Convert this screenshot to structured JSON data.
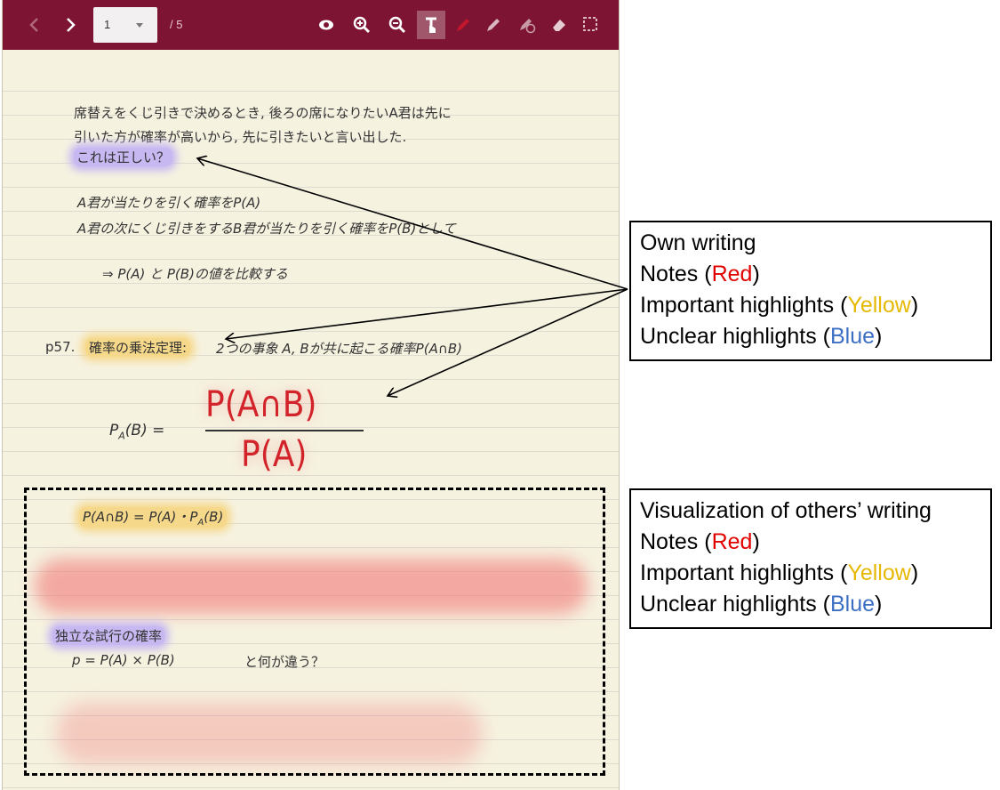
{
  "toolbar": {
    "page_current": "1",
    "page_total": "/ 5",
    "buttons": [
      "chevron-left-icon",
      "chevron-right-icon",
      "eye-icon",
      "zoom-in-icon",
      "zoom-out-icon",
      "text-cursor-icon",
      "pen-icon",
      "highlighter-icon",
      "question-highlighter-icon",
      "eraser-icon",
      "selection-icon"
    ]
  },
  "note": {
    "line1": "席替えをくじ引きで決めるとき, 後ろの席になりたいA君は先に",
    "line2": "引いた方が確率が高いから, 先に引きたいと言い出した.",
    "question": "これは正しい？",
    "pa_line": "A君が当たりを引く確率をP(A)",
    "pb_line": "A君の次にくじ引きをするB君が当たりを引く確率をP(B)として",
    "compare_line": "⇒ P(A) と P(B)の値を比較する",
    "page_ref": "p57.",
    "theorem": "確率の乗法定理:",
    "theorem_rest": "2つの事象 A, Bが共に起こる確率P(A∩B)",
    "formula_lhs": "P",
    "formula_sub": "A",
    "formula_lhs_rest": "(B) =",
    "formula_num": "P(A∩B)",
    "formula_den": "P(A)",
    "others_formula": "P(A∩B) = P(A)・P",
    "others_formula_sub": "A",
    "others_formula_rest": "(B)",
    "independent": "独立な試行の確率",
    "p_formula": "p = P(A) × P(B)",
    "diff_question": "と何が違う？"
  },
  "callouts": {
    "own": {
      "title": "Own writing",
      "notes_pre": "Notes (",
      "notes_color": "Red",
      "notes_post": ")",
      "imp_pre": "Important highlights (",
      "imp_color": "Yellow",
      "imp_post": ")",
      "unc_pre": "Unclear highlights (",
      "unc_color": "Blue",
      "unc_post": ")"
    },
    "others": {
      "title": "Visualization of others’ writing",
      "notes_pre": "Notes (",
      "notes_color": "Red",
      "notes_post": ")",
      "imp_pre": "Important highlights (",
      "imp_color": "Yellow",
      "imp_post": ")",
      "unc_pre": "Unclear highlights (",
      "unc_color": "Blue",
      "unc_post": ")"
    }
  },
  "colors": {
    "toolbar_bg": "#7d1433",
    "paper_bg": "#f6f2e0",
    "red": "#e00000",
    "yellow": "#e6b800",
    "blue": "#3c6fc4"
  }
}
